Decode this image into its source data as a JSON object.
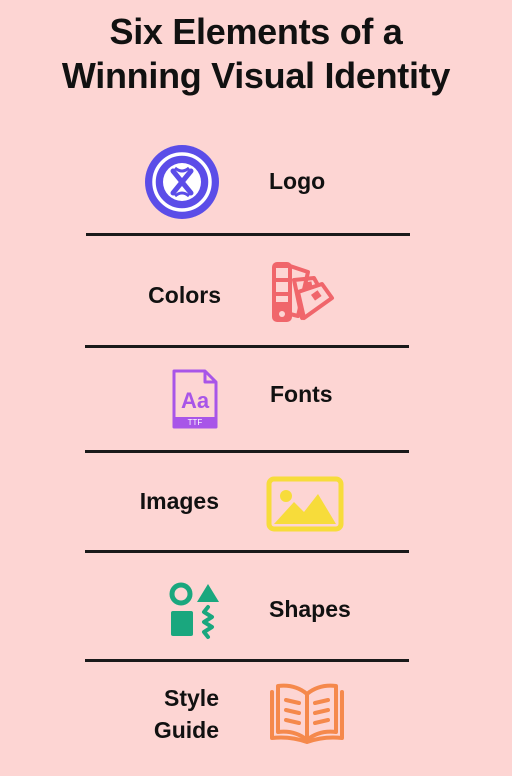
{
  "title": {
    "line1": "Six Elements of a",
    "line2": "Winning Visual Identity"
  },
  "elements": [
    {
      "label": "Logo",
      "icon": "logo-icon",
      "color": "#5b4de8"
    },
    {
      "label": "Colors",
      "icon": "color-swatches-icon",
      "color": "#f0666b"
    },
    {
      "label": "Fonts",
      "icon": "font-file-icon",
      "color": "#a855e8",
      "icon_text": "Aa",
      "icon_badge": "TTF"
    },
    {
      "label": "Images",
      "icon": "image-icon",
      "color": "#f7dc3a"
    },
    {
      "label": "Shapes",
      "icon": "shapes-icon",
      "color": "#1aa77e"
    },
    {
      "label_line1": "Style",
      "label_line2": "Guide",
      "icon": "open-book-icon",
      "color": "#f5894c"
    }
  ],
  "colors": {
    "background": "#fdd5d3",
    "text": "#111111",
    "divider": "#1a1a1a"
  }
}
